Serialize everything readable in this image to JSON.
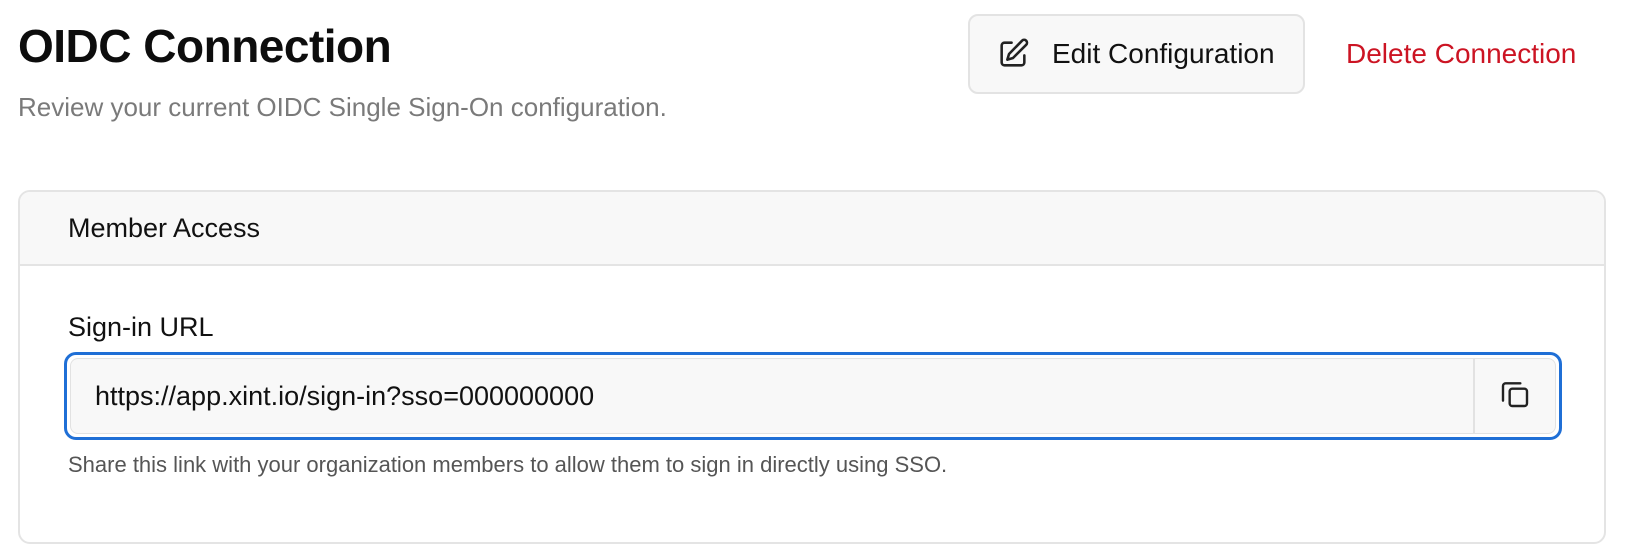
{
  "header": {
    "title": "OIDC Connection",
    "subtitle": "Review your current OIDC Single Sign-On configuration.",
    "edit_label": "Edit Configuration",
    "delete_label": "Delete Connection"
  },
  "card": {
    "title": "Member Access",
    "field_label": "Sign-in URL",
    "url_value": "https://app.xint.io/sign-in?sso=000000000",
    "help_text": "Share this link with your organization members to allow them to sign in directly using SSO."
  },
  "icons": {
    "edit": "edit-icon",
    "copy": "copy-icon"
  },
  "colors": {
    "danger": "#cc1423",
    "focus_ring": "#1f6fd6"
  }
}
